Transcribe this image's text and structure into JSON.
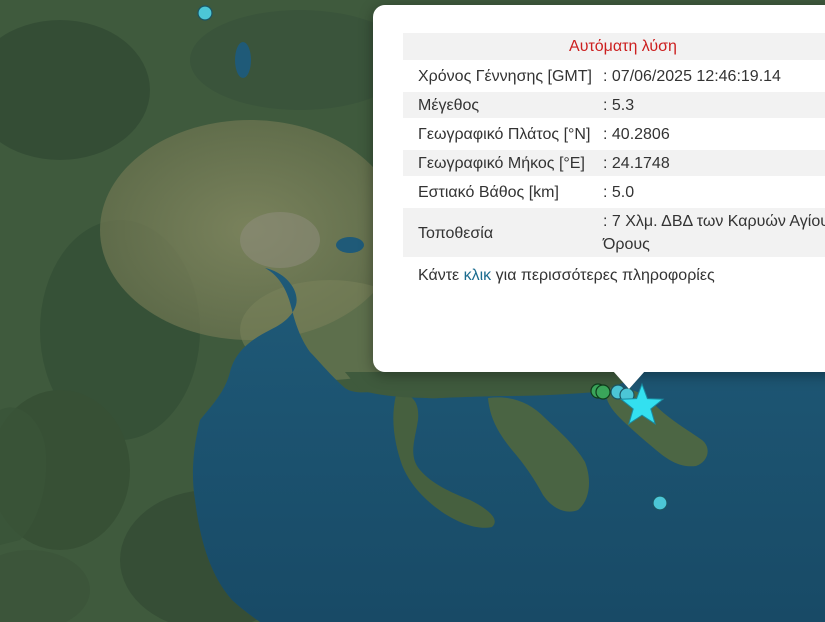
{
  "popup": {
    "title": "Αυτόματη λύση",
    "rows": [
      {
        "label": "Χρόνος Γέννησης [GMT]",
        "value": ": 07/06/2025 12:46:19.14"
      },
      {
        "label": "Μέγεθος",
        "value": ": 5.3"
      },
      {
        "label": "Γεωγραφικό Πλάτος [°N]",
        "value": ": 40.2806"
      },
      {
        "label": "Γεωγραφικό Μήκος [°E]",
        "value": ": 24.1748"
      },
      {
        "label": "Εστιακό Βάθος [km]",
        "value": ": 5.0"
      },
      {
        "label": "Τοποθεσία",
        "value": ": 7 Χλμ. ΔΒΔ των Καρυών Αγίου Όρους"
      }
    ],
    "more": {
      "prefix": "Κάντε ",
      "link": "κλικ",
      "suffix": " για περισσότερες πληροφορίες"
    }
  },
  "map": {
    "colors": {
      "sea": "#1d4f6b",
      "land": "#3f5a3d",
      "plain": "#7f8660",
      "marker_cyan": "#4cc6d6",
      "marker_green": "#3aa55a",
      "epicenter_star": "#33e0f0"
    },
    "markers": [
      {
        "name": "event-marker-north",
        "kind": "cyan-circle"
      },
      {
        "name": "event-marker-green-1",
        "kind": "green-circle"
      },
      {
        "name": "event-marker-green-2",
        "kind": "green-circle"
      },
      {
        "name": "event-marker-athos-1",
        "kind": "cyan-circle"
      },
      {
        "name": "event-marker-athos-2",
        "kind": "cyan-circle"
      },
      {
        "name": "event-marker-south",
        "kind": "cyan-circle"
      },
      {
        "name": "epicenter-star-icon",
        "kind": "star"
      }
    ]
  }
}
